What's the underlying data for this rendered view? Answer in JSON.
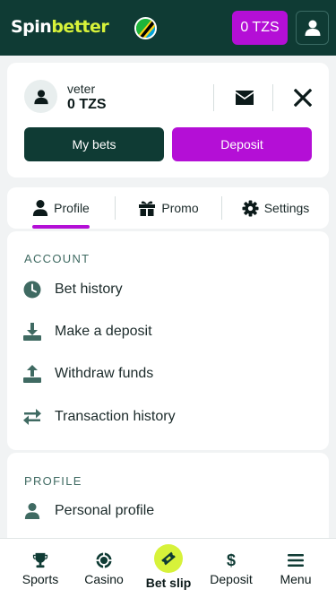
{
  "header": {
    "logo_part1": "Spin",
    "logo_part2": "better",
    "balance": "0 TZS"
  },
  "account": {
    "username": "veter",
    "balance": "0 TZS",
    "my_bets_label": "My bets",
    "deposit_label": "Deposit"
  },
  "tabs": [
    {
      "label": "Profile",
      "icon": "person-icon",
      "active": true
    },
    {
      "label": "Promo",
      "icon": "gift-icon",
      "active": false
    },
    {
      "label": "Settings",
      "icon": "gear-icon",
      "active": false
    }
  ],
  "account_section": {
    "title": "ACCOUNT",
    "items": [
      {
        "label": "Bet history",
        "icon": "clock-icon"
      },
      {
        "label": "Make a deposit",
        "icon": "download-tray-icon"
      },
      {
        "label": "Withdraw funds",
        "icon": "upload-tray-icon"
      },
      {
        "label": "Transaction history",
        "icon": "transfer-arrows-icon"
      }
    ]
  },
  "profile_section": {
    "title": "PROFILE",
    "items": [
      {
        "label": "Personal profile",
        "icon": "person-icon"
      }
    ]
  },
  "bottom_nav": [
    {
      "label": "Sports",
      "icon": "trophy-icon"
    },
    {
      "label": "Casino",
      "icon": "chip-icon"
    },
    {
      "label": "Bet slip",
      "icon": "ticket-icon"
    },
    {
      "label": "Deposit",
      "icon": "dollar-icon"
    },
    {
      "label": "Menu",
      "icon": "hamburger-icon"
    }
  ],
  "colors": {
    "brand_dark": "#0f3b34",
    "accent_purple": "#b40fd6",
    "accent_lime": "#d7f23a"
  }
}
